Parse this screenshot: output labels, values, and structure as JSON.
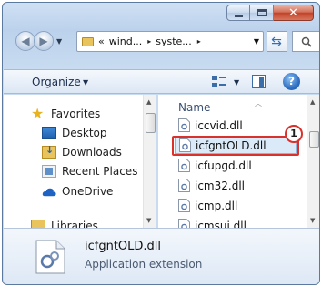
{
  "window": {
    "caption_buttons": {
      "minimize": "",
      "maximize": "",
      "close": "✕"
    }
  },
  "address_bar": {
    "overflow_chevron": "«",
    "crumbs": [
      "wind...",
      "syste..."
    ],
    "separator": "▸"
  },
  "toolbar": {
    "organize_label": "Organize",
    "help_label": "?"
  },
  "nav_pane": {
    "items": [
      {
        "label": "Favorites",
        "icon": "star-icon"
      },
      {
        "label": "Desktop",
        "icon": "desktop-icon"
      },
      {
        "label": "Downloads",
        "icon": "downloads-icon"
      },
      {
        "label": "Recent Places",
        "icon": "recent-places-icon"
      },
      {
        "label": "OneDrive",
        "icon": "onedrive-icon"
      },
      {
        "label": "Libraries",
        "icon": "libraries-icon"
      }
    ]
  },
  "file_list": {
    "column_header": "Name",
    "files": [
      {
        "name": "iccvid.dll",
        "selected": false
      },
      {
        "name": "icfgntOLD.dll",
        "selected": true
      },
      {
        "name": "icfupgd.dll",
        "selected": false
      },
      {
        "name": "icm32.dll",
        "selected": false
      },
      {
        "name": "icmp.dll",
        "selected": false
      },
      {
        "name": "icmsui.dll",
        "selected": false
      }
    ],
    "callout_number": "1"
  },
  "details": {
    "file_name": "icfgntOLD.dll",
    "file_type": "Application extension"
  },
  "colors": {
    "highlight": "#d9312b",
    "selection": "#dbeaf8",
    "folder": "#e9c35b"
  }
}
